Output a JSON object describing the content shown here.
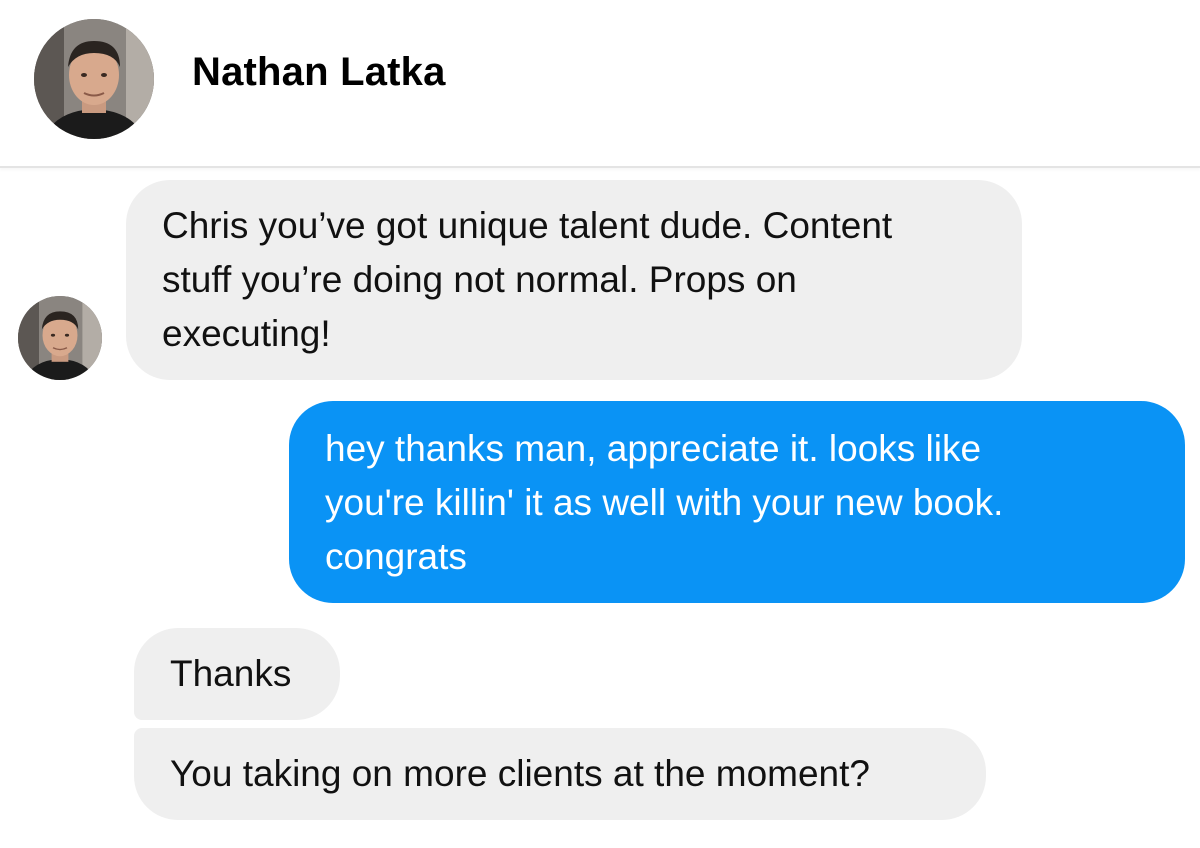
{
  "contact": {
    "name": "Nathan Latka",
    "avatar_icon": "profile-photo"
  },
  "messages": [
    {
      "direction": "incoming",
      "text": "Chris you’ve got unique talent dude. Content\nstuff you’re doing not normal. Props on\nexecuting!"
    },
    {
      "direction": "outgoing",
      "text": "hey thanks man, appreciate it. looks like\nyou're killin' it as well with your new book.\ncongrats"
    },
    {
      "direction": "incoming",
      "text": "Thanks"
    },
    {
      "direction": "incoming",
      "text": "You taking on more clients at the moment?"
    }
  ],
  "colors": {
    "incoming_bubble": "#efefef",
    "outgoing_bubble": "#0a93f5",
    "outgoing_text": "#ffffff",
    "incoming_text": "#111111"
  }
}
